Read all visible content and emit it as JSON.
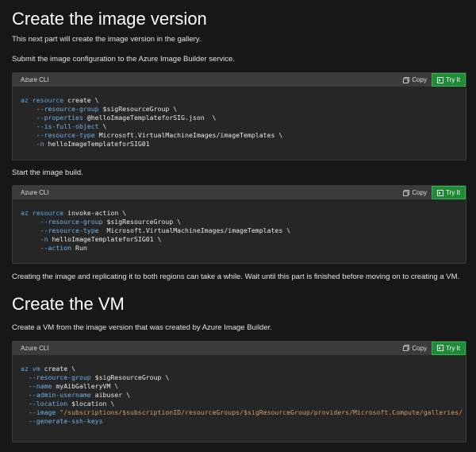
{
  "section1": {
    "title": "Create the image version",
    "intro": "This next part will create the image version in the gallery.",
    "submit_text": "Submit the image configuration to the Azure Image Builder service.",
    "block1": {
      "lang": "Azure CLI",
      "copy": "Copy",
      "try": "Try It",
      "lines": [
        [
          "az resource create \\"
        ],
        [
          "    --resource-group",
          " $sigResourceGroup \\"
        ],
        [
          "    --properties",
          " @helloImageTemplateforSIG.json  \\"
        ],
        [
          "    --is-full-object",
          " \\"
        ],
        [
          "    --resource-type",
          " Microsoft.VirtualMachineImages/imageTemplates \\"
        ],
        [
          "    -n",
          " helloImageTemplateforSIG01"
        ]
      ]
    },
    "start_text": "Start the image build.",
    "block2": {
      "lang": "Azure CLI",
      "copy": "Copy",
      "try": "Try It",
      "lines": [
        [
          "az resource invoke-action \\"
        ],
        [
          "     --resource-group",
          " $sigResourceGroup \\"
        ],
        [
          "     --resource-type",
          "  Microsoft.VirtualMachineImages/imageTemplates \\"
        ],
        [
          "     -n",
          " helloImageTemplateforSIG01 \\"
        ],
        [
          "     --action",
          " Run"
        ]
      ]
    },
    "note": "Creating the image and replicating it to both regions can take a while. Wait until this part is finished before moving on to creating a VM."
  },
  "section2": {
    "title": "Create the VM",
    "intro": "Create a VM from the image version that was created by Azure Image Builder.",
    "block3": {
      "lang": "Azure CLI",
      "copy": "Copy",
      "try": "Try It",
      "lines": [
        [
          "az vm create \\"
        ],
        [
          "  --resource-group",
          " $sigResourceGroup \\"
        ],
        [
          "  --name",
          " myAibGalleryVM \\"
        ],
        [
          "  --admin-username",
          " aibuser \\"
        ],
        [
          "  --location",
          " $location \\"
        ],
        [
          "  --image",
          " \"/subscriptions/$subscriptionID/resourceGroups/$sigResourceGroup/providers/Microsoft.Compute/galleries/"
        ],
        [
          "  --generate-ssh-keys"
        ]
      ]
    }
  },
  "colors": {
    "background": "#171717",
    "code_bg": "#262626",
    "header_bg": "#3b3b3b",
    "try_it": "#1f8a38",
    "keyword": "#5aa6e6",
    "string": "#d49a6a"
  }
}
